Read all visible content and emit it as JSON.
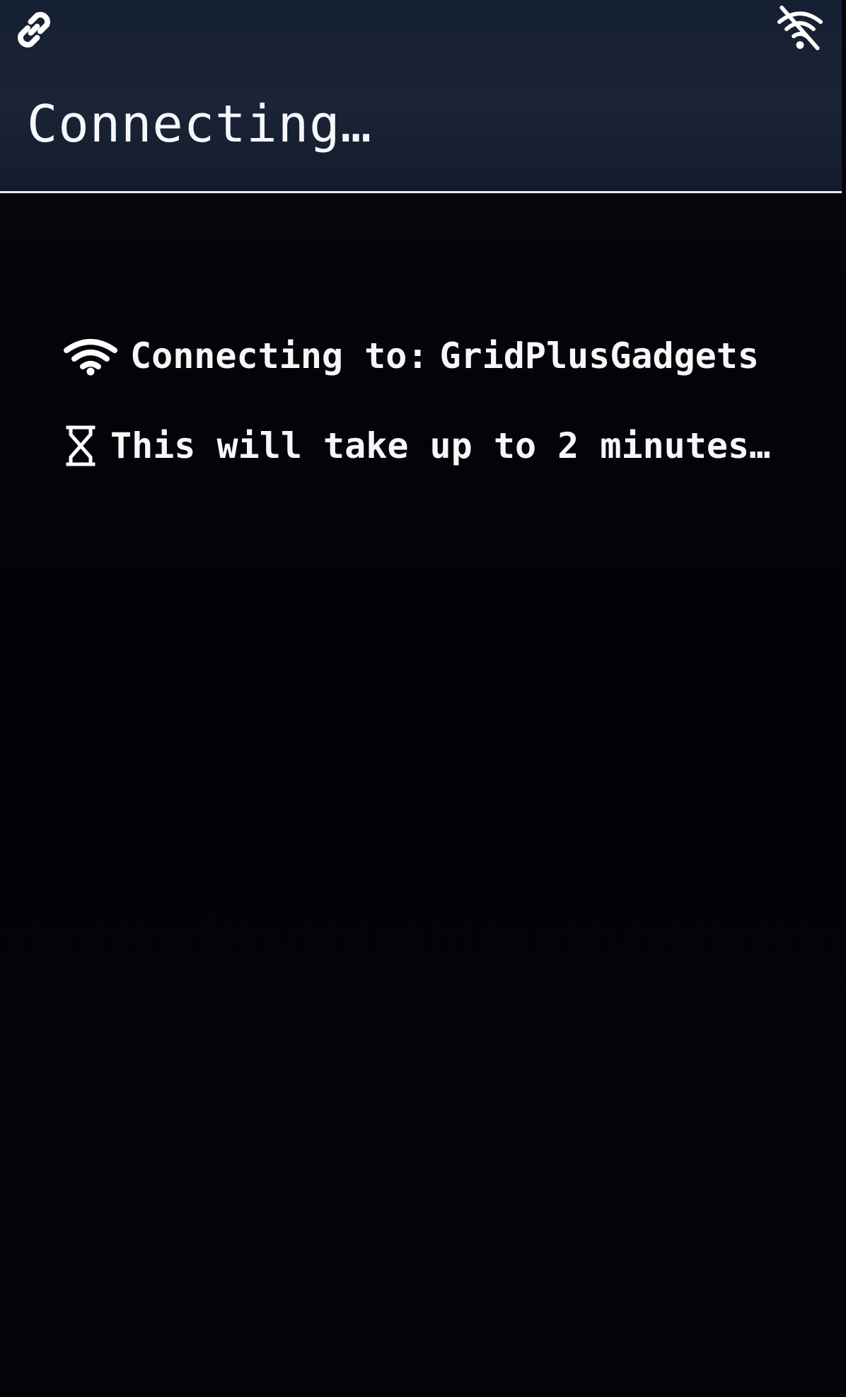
{
  "header": {
    "title": "Connecting…",
    "status_icons": {
      "left": "link-icon",
      "right": "wifi-off-icon"
    }
  },
  "content": {
    "lines": [
      {
        "icon": "wifi-icon",
        "label": "Connecting to:",
        "network": "GridPlusGadgets"
      },
      {
        "icon": "hourglass-icon",
        "text": "This will take up to 2 minutes…"
      }
    ]
  },
  "colors": {
    "header_bg": "#1a2436",
    "content_bg": "#020308",
    "text": "#f7f7f7",
    "divider": "#e9ecf2"
  }
}
